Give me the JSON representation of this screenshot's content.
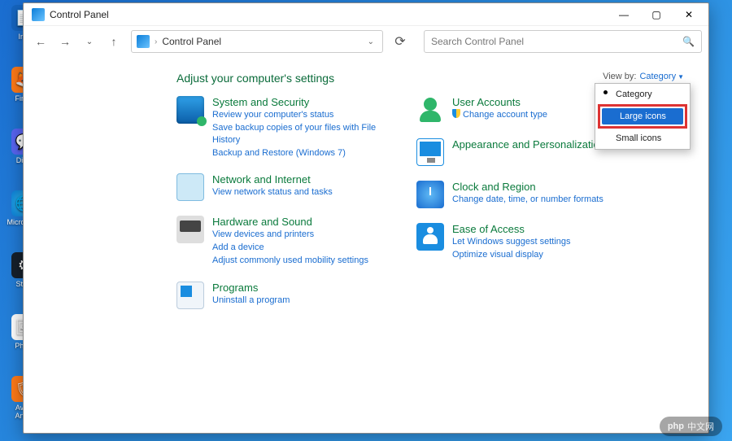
{
  "titlebar": {
    "title": "Control Panel"
  },
  "address": {
    "crumb": "Control Panel"
  },
  "search": {
    "placeholder": "Search Control Panel"
  },
  "heading": "Adjust your computer's settings",
  "viewby": {
    "label": "View by:",
    "value": "Category"
  },
  "dropdown": {
    "items": [
      {
        "label": "Category",
        "selected": false,
        "bulleted": true
      },
      {
        "label": "Large icons",
        "selected": true,
        "highlighted": true
      },
      {
        "label": "Small icons",
        "selected": false
      }
    ]
  },
  "left": [
    {
      "title": "System and Security",
      "links": [
        "Review your computer's status",
        "Save backup copies of your files with File History",
        "Backup and Restore (Windows 7)"
      ]
    },
    {
      "title": "Network and Internet",
      "links": [
        "View network status and tasks"
      ]
    },
    {
      "title": "Hardware and Sound",
      "links": [
        "View devices and printers",
        "Add a device",
        "Adjust commonly used mobility settings"
      ]
    },
    {
      "title": "Programs",
      "links": [
        "Uninstall a program"
      ]
    }
  ],
  "right": [
    {
      "title": "User Accounts",
      "links": [
        "Change account type"
      ],
      "shield_on_link": true
    },
    {
      "title": "Appearance and Personalization",
      "links": []
    },
    {
      "title": "Clock and Region",
      "links": [
        "Change date, time, or number formats"
      ]
    },
    {
      "title": "Ease of Access",
      "links": [
        "Let Windows suggest settings",
        "Optimize visual display"
      ]
    }
  ],
  "desktop": [
    "In...",
    "Fire...",
    "Dis...",
    "Micro\nEd...",
    "Ste...",
    "Pho...",
    "Avast\nAnti..."
  ],
  "watermark": "php 中文网"
}
